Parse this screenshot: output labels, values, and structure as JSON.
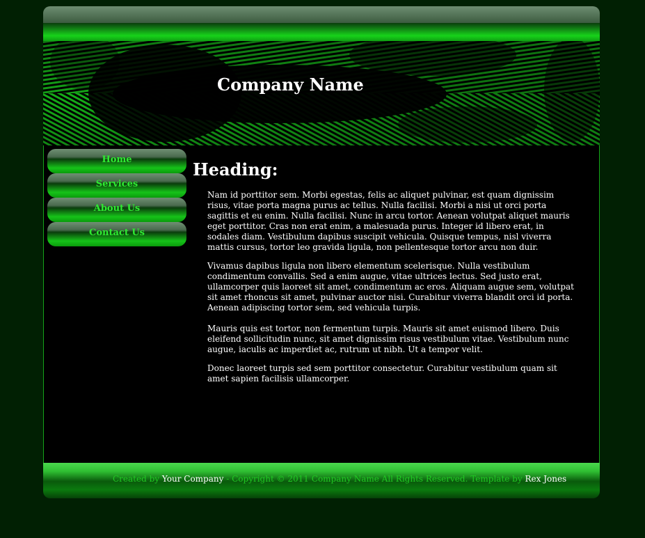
{
  "header": {
    "company_name": "Company Name"
  },
  "nav": {
    "items": [
      {
        "label": "Home"
      },
      {
        "label": "Services"
      },
      {
        "label": "About Us"
      },
      {
        "label": "Contact Us"
      }
    ]
  },
  "content": {
    "heading": "Heading:",
    "paragraphs": [
      "Nam id porttitor sem. Morbi egestas, felis ac aliquet pulvinar, est quam dignissim risus, vitae porta magna purus ac tellus. Nulla facilisi. Morbi a nisi ut orci porta sagittis et eu enim. Nulla facilisi. Nunc in arcu tortor. Aenean volutpat aliquet mauris eget porttitor. Cras non erat enim, a malesuada purus. Integer id libero erat, in sodales diam. Vestibulum dapibus suscipit vehicula. Quisque tempus, nisl viverra mattis cursus, tortor leo gravida ligula, non pellentesque tortor arcu non duir.",
      "Vivamus dapibus ligula non libero elementum scelerisque. Nulla vestibulum condimentum convallis. Sed a enim augue, vitae ultrices lectus. Sed justo erat, ullamcorper quis laoreet sit amet, condimentum ac eros. Aliquam augue sem, volutpat sit amet rhoncus sit amet, pulvinar auctor nisi. Curabitur viverra blandit orci id porta. Aenean adipiscing tortor sem, sed vehicula turpis.",
      "Mauris quis est tortor, non fermentum turpis. Mauris sit amet euismod libero. Duis eleifend sollicitudin nunc, sit amet dignissim risus vestibulum vitae. Vestibulum nunc augue, iaculis ac imperdiet ac, rutrum ut nibh. Ut a tempor velit.",
      "Donec laoreet turpis sed sem porttitor consectetur. Curabitur vestibulum quam sit amet sapien facilisis ullamcorper."
    ]
  },
  "footer": {
    "created_by": "Created by",
    "your_company": "Your Company",
    "copyright": "- Copyright © 2011 Company Name All Rights Reserved.  Template by",
    "author": "Rex Jones"
  },
  "colors": {
    "page_background": "#012003",
    "accent_green": "#2eea31",
    "footer_text": "#1fc822",
    "content_background": "#000000"
  }
}
